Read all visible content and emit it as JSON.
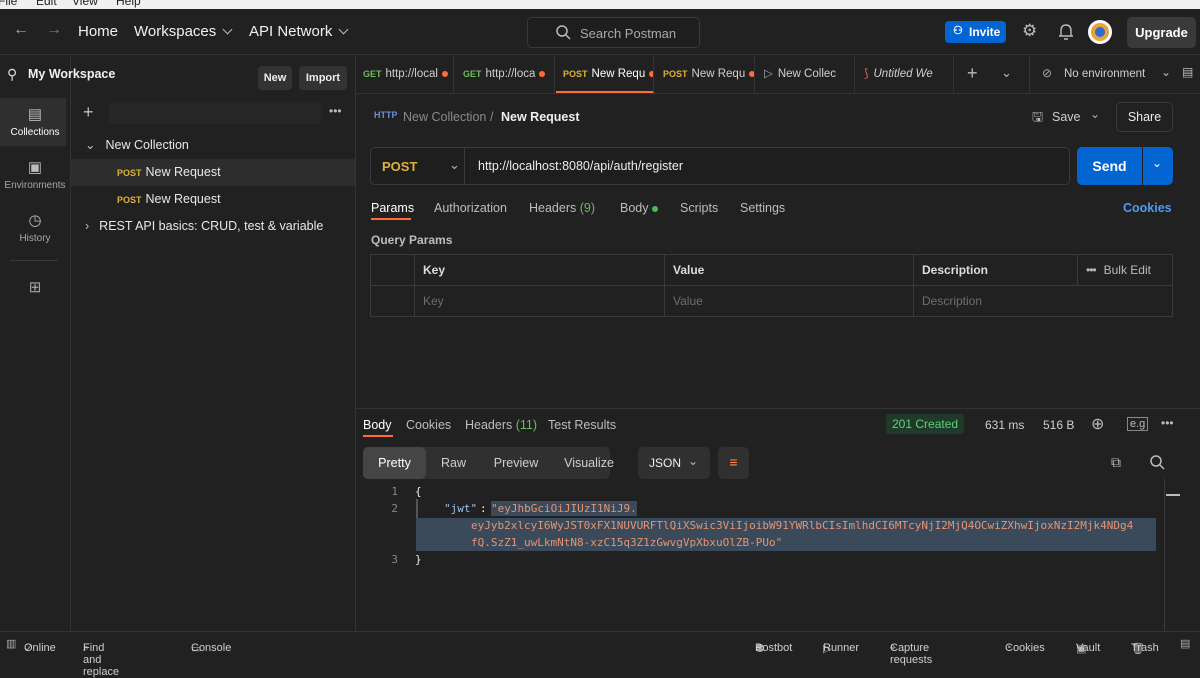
{
  "menubar": {
    "items": [
      "File",
      "Edit",
      "View",
      "Help"
    ]
  },
  "topnav": {
    "home": "Home",
    "workspaces": "Workspaces",
    "api_network": "API Network",
    "search_placeholder": "Search Postman",
    "invite": "Invite",
    "upgrade": "Upgrade"
  },
  "rail": {
    "items": [
      {
        "label": "Collections",
        "icon": "collections-icon"
      },
      {
        "label": "Environments",
        "icon": "environments-icon"
      },
      {
        "label": "History",
        "icon": "history-icon"
      }
    ]
  },
  "sidebar": {
    "workspace": "My Workspace",
    "new_btn": "New",
    "import_btn": "Import",
    "tree": [
      {
        "label": "New Collection",
        "method": ""
      },
      {
        "label": "New Request",
        "method": "POST"
      },
      {
        "label": "New Request",
        "method": "POST"
      },
      {
        "label": "REST API basics: CRUD, test & variable",
        "method": ""
      }
    ]
  },
  "tabs": [
    {
      "method": "GET",
      "label": "http://local"
    },
    {
      "method": "GET",
      "label": "http://loca"
    },
    {
      "method": "POST",
      "label": "New Requ"
    },
    {
      "method": "POST",
      "label": "New Requ"
    },
    {
      "method": "",
      "label": "New Collec"
    },
    {
      "method": "",
      "label": "Untitled We"
    }
  ],
  "environment": "No environment",
  "request": {
    "breadcrumb_parent": "New Collection",
    "breadcrumb_sep": "/",
    "title": "New Request",
    "save": "Save",
    "share": "Share",
    "method": "POST",
    "url": "http://localhost:8080/api/auth/register",
    "send": "Send",
    "tabs": [
      "Params",
      "Authorization",
      "Headers",
      "Body",
      "Scripts",
      "Settings"
    ],
    "headers_count": "(9)",
    "cookies": "Cookies",
    "query_params_title": "Query Params",
    "columns": [
      "Key",
      "Value",
      "Description"
    ],
    "bulk_edit": "Bulk Edit",
    "placeholders": [
      "Key",
      "Value",
      "Description"
    ]
  },
  "response": {
    "tabs": [
      "Body",
      "Cookies",
      "Headers",
      "Test Results"
    ],
    "headers_count": "(11)",
    "status": "201 Created",
    "time": "631 ms",
    "size": "516 B",
    "views": [
      "Pretty",
      "Raw",
      "Preview",
      "Visualize"
    ],
    "format": "JSON",
    "code": {
      "l1": "{",
      "key": "\"jwt\"",
      "colon": ": ",
      "v1": "\"eyJhbGciOiJIUzI1NiJ9.",
      "v2": "eyJyb2xlcyI6WyJST0xFX1NUVURFTlQiXSwic3ViIjoibW91YWRlbCIsImlhdCI6MTcyNjI2MjQ4OCwiZXhwIjoxNzI2Mjk4NDg4",
      "v3": "fQ.SzZ1_uwLkmNtN8-xzC15q3Z1zGwvgVpXbxuOlZB-PUo\"",
      "l3": "}"
    },
    "line_numbers": [
      "1",
      "2",
      "3"
    ]
  },
  "statusbar": {
    "online": "Online",
    "find": "Find and replace",
    "console": "Console",
    "postbot": "Postbot",
    "runner": "Runner",
    "capture": "Capture requests",
    "cookies": "Cookies",
    "vault": "Vault",
    "trash": "Trash"
  }
}
